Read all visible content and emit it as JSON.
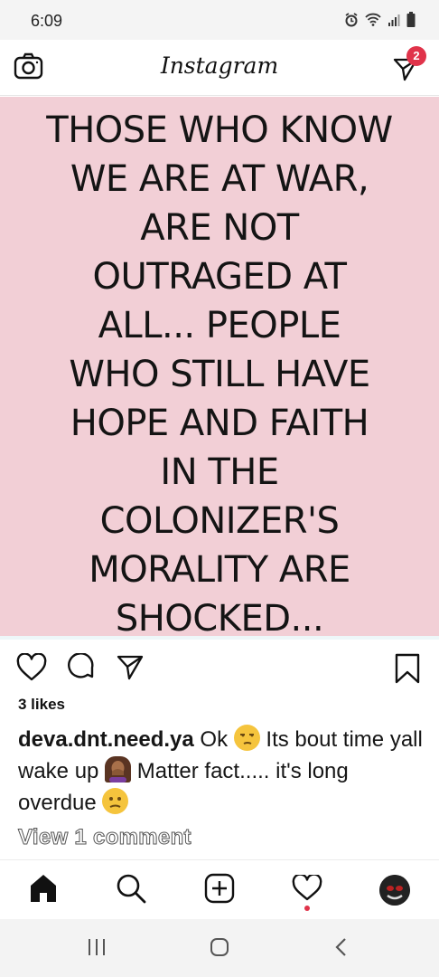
{
  "status_bar": {
    "time": "6:09"
  },
  "header": {
    "app_title": "Instagram",
    "dm_badge": "2"
  },
  "post": {
    "lines": [
      "THOSE WHO KNOW",
      "WE ARE AT WAR,",
      "ARE NOT",
      "OUTRAGED AT",
      "ALL... PEOPLE",
      "WHO STILL HAVE",
      "HOPE AND FAITH",
      "IN THE",
      "COLONIZER'S",
      "MORALITY ARE",
      "SHOCKED..."
    ],
    "background": "#f2cfd6"
  },
  "engagement": {
    "likes": "3 likes"
  },
  "caption": {
    "username": "deva.dnt.need.ya",
    "part1": "Ok",
    "emoji1": "unamused-face",
    "part2": "Its bout time yall wake up",
    "emoji2": "person-facepalming",
    "part3": "Matter fact..... it's long overdue",
    "emoji3": "confused-face"
  },
  "comments": {
    "view_label": "View 1 comment"
  },
  "bottom_nav": {
    "items": [
      "home-icon",
      "search-icon",
      "new-post-icon",
      "activity-icon",
      "profile-avatar"
    ],
    "activity_dot_color": "#e0334a"
  }
}
